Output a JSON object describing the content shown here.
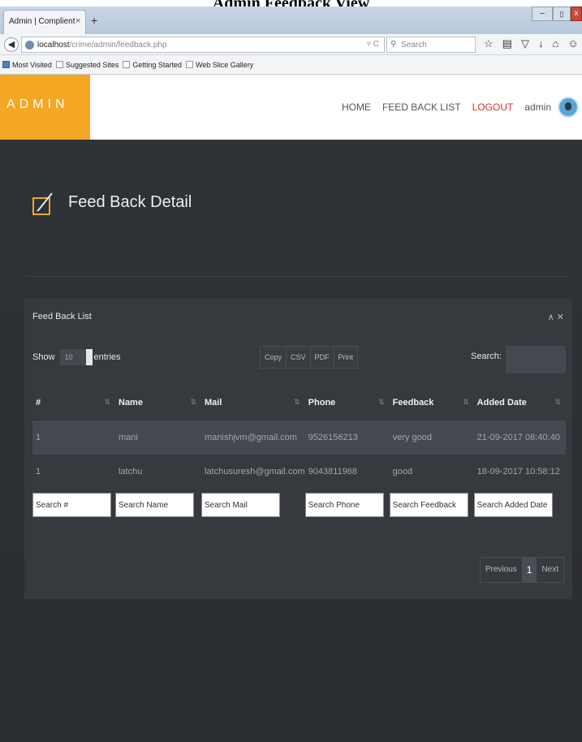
{
  "caption": "Admin Feedback View",
  "browser": {
    "tab_title": "Admin | Complient",
    "tab_close": "×",
    "new_tab": "+",
    "win_min": "–",
    "win_max": "▯",
    "win_close": "x",
    "url_host": "localhost",
    "url_path": "/crime/admin/feedback.php",
    "url_icons": "▿ C",
    "search_placeholder": "Search",
    "bookmarks": [
      "Most Visited",
      "Suggested Sites",
      "Getting Started",
      "Web Slice Gallery"
    ]
  },
  "header": {
    "brand": "ADMIN",
    "menu": [
      "HOME",
      "FEED BACK LIST",
      "LOGOUT",
      "admin"
    ]
  },
  "page": {
    "title": "Feed Back Detail"
  },
  "panel": {
    "title": "Feed Back List",
    "tools": "∧ ✕",
    "show_label": "Show",
    "entries_value": "10",
    "entries_label": "entries",
    "export_buttons": [
      "Copy",
      "CSV",
      "PDF",
      "Print"
    ],
    "search_label": "Search:",
    "sort_glyph": "⇅",
    "columns": [
      "#",
      "Name",
      "Mail",
      "Phone",
      "Feedback",
      "Added Date"
    ],
    "rows": [
      [
        "1",
        "mani",
        "manishjvm@gmail.com",
        "9526156213",
        "very good",
        "21-09-2017 08:40:40"
      ],
      [
        "1",
        "latchu",
        "latchusuresh@gmail.com",
        "9043811968",
        "good",
        "18-09-2017 10:58:12"
      ]
    ],
    "filters": [
      "Search #",
      "Search Name",
      "Search Mail",
      "Search Phone",
      "Search Feedback",
      "Search Added Date"
    ],
    "pager": {
      "previous": "Previous",
      "current": "1",
      "next": "Next"
    }
  },
  "colors": {
    "accent": "#f5a623",
    "logout": "#d9302b",
    "background": "#2b2e33"
  }
}
